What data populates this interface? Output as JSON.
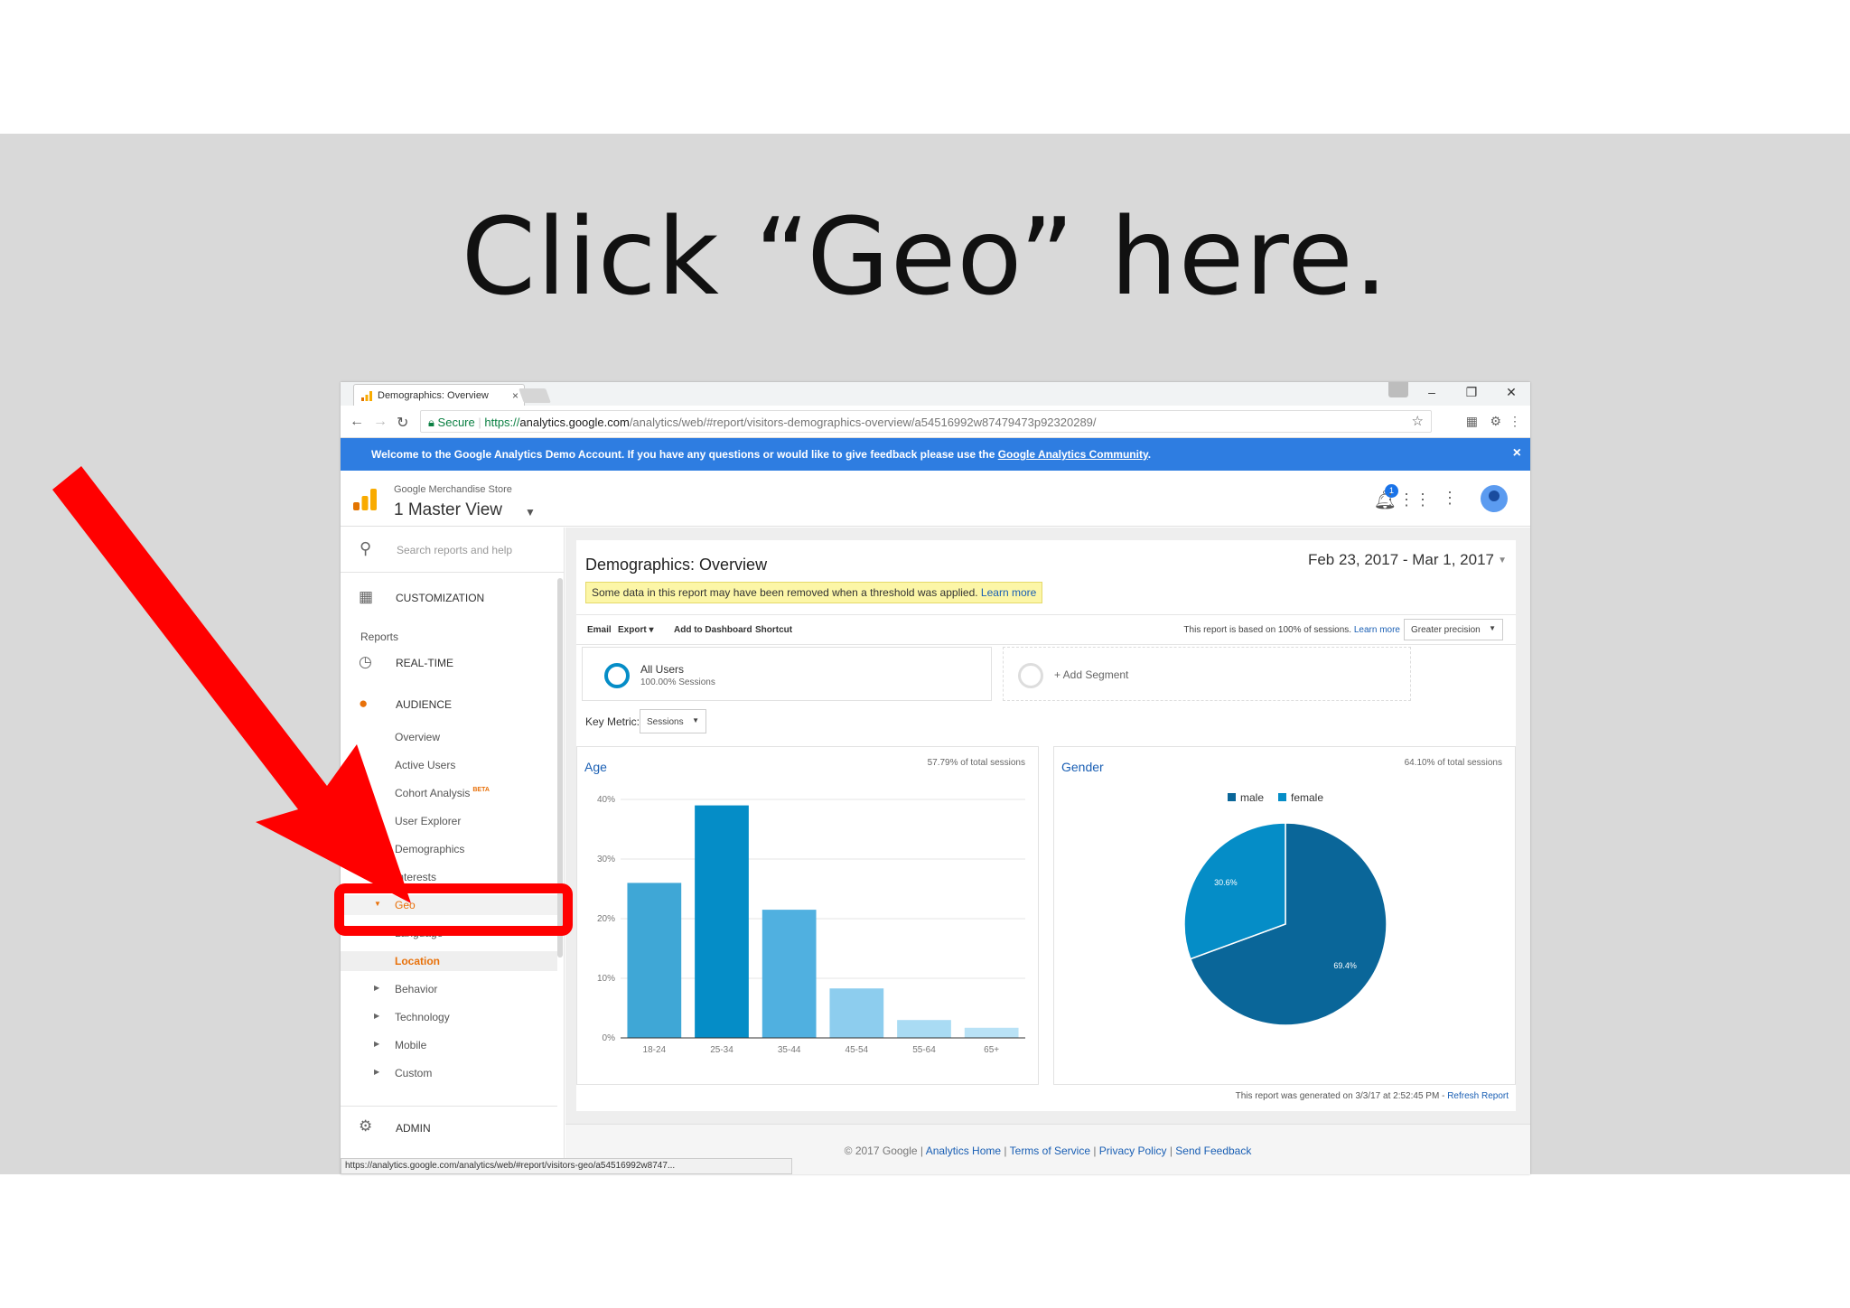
{
  "slide": {
    "title": "Click “Geo” here."
  },
  "browser": {
    "tab_title": "Demographics: Overview",
    "tab_close": "×",
    "url_secure": "Secure",
    "url_scheme": "https://",
    "url_host": "analytics.google.com",
    "url_path": "/analytics/web/#report/visitors-demographics-overview/a54516992w87479473p92320289/",
    "status_url": "https://analytics.google.com/analytics/web/#report/visitors-geo/a54516992w8747..."
  },
  "welcome_banner": {
    "text": "Welcome to the Google Analytics Demo Account. If you have any questions or would like to give feedback please use the ",
    "link": "Google Analytics Community",
    "tail": ".",
    "close": "×"
  },
  "header": {
    "account": "Google Merchandise Store",
    "view": "1 Master View",
    "notification_count": "1"
  },
  "sidebar": {
    "search_placeholder": "Search reports and help",
    "customization": "CUSTOMIZATION",
    "reports_heading": "Reports",
    "realtime": "REAL-TIME",
    "audience": "AUDIENCE",
    "audience_items": [
      {
        "label": "Overview"
      },
      {
        "label": "Active Users"
      },
      {
        "label": "Cohort Analysis",
        "badge": "BETA"
      },
      {
        "label": "User Explorer"
      },
      {
        "label": "Demographics"
      },
      {
        "label": "Interests"
      },
      {
        "label": "Geo"
      },
      {
        "label": "Language"
      },
      {
        "label": "Location"
      },
      {
        "label": "Behavior"
      },
      {
        "label": "Technology"
      },
      {
        "label": "Mobile"
      },
      {
        "label": "Custom"
      }
    ],
    "admin": "ADMIN"
  },
  "report": {
    "title": "Demographics: Overview",
    "date_range": "Feb 23, 2017 - Mar 1, 2017",
    "notice": "Some data in this report may have been removed when a threshold was applied. ",
    "notice_link": "Learn more",
    "actions": [
      "Email",
      "Export",
      "Add to Dashboard",
      "Shortcut"
    ],
    "basis_text": "This report is based on 100% of sessions. ",
    "basis_link": "Learn more",
    "precision": "Greater precision",
    "segment_name": "All Users",
    "segment_sub": "100.00% Sessions",
    "add_segment": "+ Add Segment",
    "key_metric_label": "Key Metric:",
    "key_metric_value": "Sessions",
    "generated_note": "This report was generated on 3/3/17 at 2:52:45 PM - ",
    "refresh_link": "Refresh Report"
  },
  "age_panel": {
    "title": "Age",
    "note": "57.79% of total sessions"
  },
  "gender_panel": {
    "title": "Gender",
    "note": "64.10% of total sessions"
  },
  "chart_data": [
    {
      "type": "bar",
      "title": "Age",
      "categories": [
        "18-24",
        "25-34",
        "35-44",
        "45-54",
        "55-64",
        "65+"
      ],
      "values": [
        26,
        39,
        21.5,
        8.3,
        3,
        1.7
      ],
      "ylim": [
        0,
        40
      ],
      "yticks": [
        "0%",
        "10%",
        "20%",
        "30%",
        "40%"
      ],
      "colors": [
        "#3fa7d6",
        "#058dc7",
        "#50b0e0",
        "#8dcdee",
        "#a9dbf3",
        "#b9e2f6"
      ],
      "grid": true
    },
    {
      "type": "pie",
      "title": "Gender",
      "legend_position": "top",
      "slices": [
        {
          "label": "male",
          "value": 69.4,
          "display": "69.4%",
          "color": "#0a6699"
        },
        {
          "label": "female",
          "value": 30.6,
          "display": "30.6%",
          "color": "#058dc7"
        }
      ]
    }
  ],
  "footer": {
    "copyright": "© 2017 Google | ",
    "links": [
      "Analytics Home",
      "Terms of Service",
      "Privacy Policy",
      "Send Feedback"
    ]
  },
  "colors": {
    "banner": "#2e7de1",
    "highlight": "#ff0000",
    "accent_orange": "#e8710a",
    "link": "#1a5fb4"
  }
}
